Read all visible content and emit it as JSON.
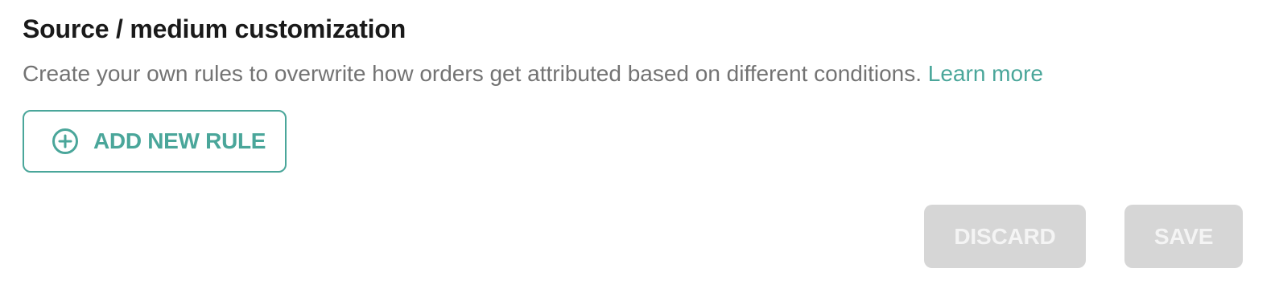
{
  "section": {
    "title": "Source / medium customization",
    "description": "Create your own rules to overwrite how orders get attributed based on different conditions.",
    "learn_more_label": "Learn more"
  },
  "add_rule_button": {
    "label": "ADD NEW RULE",
    "icon": "plus-circle-icon"
  },
  "footer": {
    "discard_label": "DISCARD",
    "save_label": "SAVE",
    "buttons_disabled": true
  },
  "colors": {
    "accent": "#4aa69a",
    "title_text": "#1a1a1a",
    "body_text": "#737373",
    "disabled_bg": "#d6d6d6",
    "disabled_text": "#f4f4f4"
  }
}
